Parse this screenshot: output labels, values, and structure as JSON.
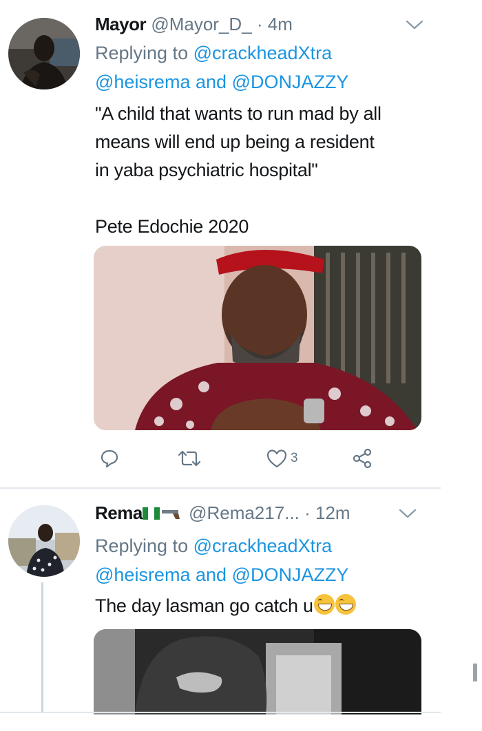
{
  "tweets": [
    {
      "name": "Mayor",
      "handle": "@Mayor_D_",
      "separator": "·",
      "time": "4m",
      "replying_prefix": "Replying to ",
      "replying_user1": "@crackheadXtra",
      "replying_user2": "@heisrema",
      "replying_and": " and ",
      "replying_user3": "@DONJAZZY",
      "text_lines": [
        "\"A child that wants to run mad by all",
        "means will end up being a resident",
        "in yaba psychiatric hospital\"",
        "",
        "Pete Edochie 2020"
      ],
      "actions": {
        "reply_count": "",
        "retweet_count": "",
        "like_count": "3"
      }
    },
    {
      "name": "Rema",
      "handle": "@Rema217...",
      "separator": "·",
      "time": "12m",
      "replying_prefix": "Replying to ",
      "replying_user1": "@crackheadXtra",
      "replying_user2": "@heisrema",
      "replying_and": " and ",
      "replying_user3": "@DONJAZZY",
      "text": "The day lasman go catch u",
      "emojis": [
        "face-with-tears-of-joy-emoji",
        "face-with-tears-of-joy-emoji"
      ],
      "name_emojis": [
        "nigeria-flag-emoji",
        "pistol-emoji"
      ]
    }
  ],
  "colors": {
    "link": "#1b95e0",
    "secondary_text": "#657786",
    "primary_text": "#14171a",
    "divider": "#e1e8ed"
  }
}
